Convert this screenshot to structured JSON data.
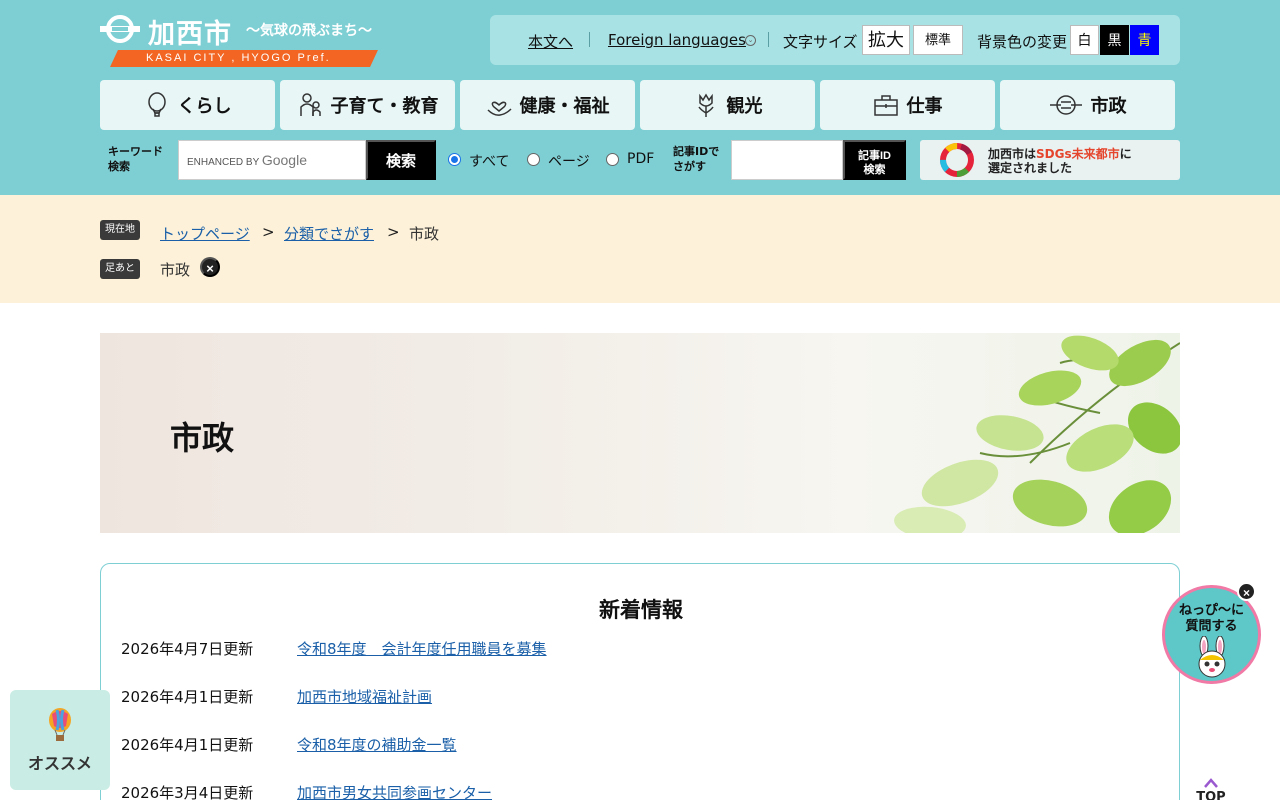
{
  "site": {
    "name": "加西市",
    "catch": "〜気球の飛ぶまち〜",
    "band": "KASAI CITY , HYOGO Pref."
  },
  "utility": {
    "skip_link": "本文へ",
    "foreign": "Foreign languages",
    "font_size_label": "文字サイズ",
    "font_large": "拡大",
    "font_normal": "標準",
    "bg_label": "背景色の変更",
    "bg_white": "白",
    "bg_black": "黒",
    "bg_blue": "青"
  },
  "global_nav": [
    {
      "label": "くらし",
      "icon": "balloon-icon"
    },
    {
      "label": "子育て・教育",
      "icon": "parent-child-icon"
    },
    {
      "label": "健康・福祉",
      "icon": "hand-heart-icon"
    },
    {
      "label": "観光",
      "icon": "tulip-icon"
    },
    {
      "label": "仕事",
      "icon": "briefcase-icon"
    },
    {
      "label": "市政",
      "icon": "city-emblem-icon"
    }
  ],
  "search": {
    "keyword_label_1": "キーワード",
    "keyword_label_2": "検索",
    "placeholder_small": "ENHANCED BY",
    "placeholder_brand": "Google",
    "button": "検索",
    "scope": [
      {
        "label": "すべて",
        "checked": true
      },
      {
        "label": "ページ",
        "checked": false
      },
      {
        "label": "PDF",
        "checked": false
      }
    ],
    "id_label_1": "記事IDで",
    "id_label_2": "さがす",
    "id_button_1": "記事ID",
    "id_button_2": "検索"
  },
  "sdgs": {
    "line1_a": "加西市は",
    "line1_hl": "SDGs未来都市",
    "line1_b": "に",
    "line2": "選定されました"
  },
  "breadcrumb": {
    "tag": "現在地",
    "items": [
      "トップページ",
      "分類でさがす"
    ],
    "separator": ">",
    "current": "市政",
    "footprint_tag": "足あと",
    "footprint_item": "市政",
    "footprint_close": "×"
  },
  "hero": {
    "title": "市政"
  },
  "news": {
    "title": "新着情報",
    "items": [
      {
        "date": "2026年4月7日更新",
        "title": "令和8年度　会計年度任用職員を募集"
      },
      {
        "date": "2026年4月1日更新",
        "title": "加西市地域福祉計画"
      },
      {
        "date": "2026年4月1日更新",
        "title": "令和8年度の補助金一覧"
      },
      {
        "date": "2026年3月4日更新",
        "title": "加西市男女共同参画センター"
      }
    ]
  },
  "floating": {
    "osusume": "オススメ",
    "chat_1": "ねっぴ〜に",
    "chat_2": "質問する",
    "chat_close": "×",
    "top": "TOP"
  },
  "colors": {
    "header_bg": "#7ecfd4",
    "nav_bg": "#e8f6f6",
    "crumb_bg": "#fdf2d9",
    "link": "#1a5fa8",
    "accent_orange": "#f26522"
  }
}
